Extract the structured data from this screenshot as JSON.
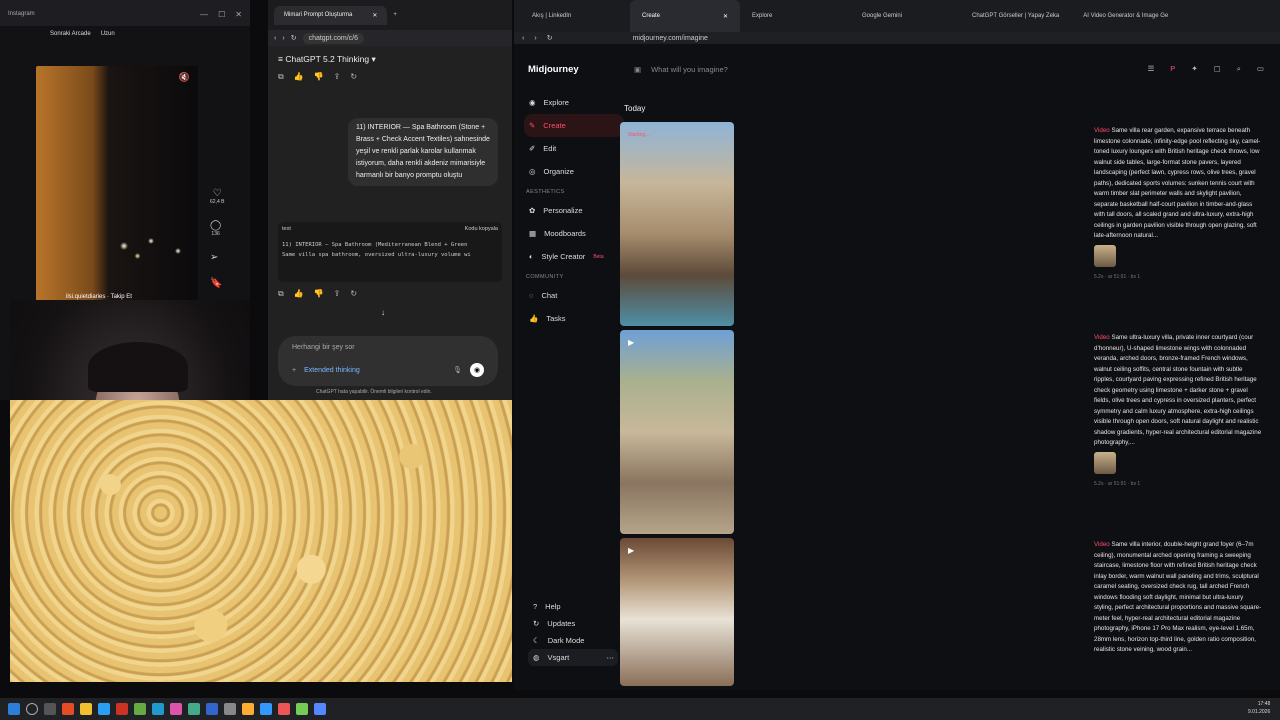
{
  "instagram": {
    "window_title": "Instagram",
    "header_items": [
      "Sonraki Arcade",
      "Uzun"
    ],
    "likes": "62,4 B",
    "comments": "136",
    "user": "ilsi.quietdiaries",
    "follow": "Takip Et"
  },
  "gpt": {
    "tab_title": "Mimari Prompt Oluşturma",
    "url": "chatgpt.com/c/6",
    "model": "ChatGPT 5.2 Thinking",
    "user_message": "11) INTERIOR — Spa Bathroom (Stone + Brass + Check Accent Textiles) sahnesinde yeşil ve renkli parlak karolar kullanmak istiyorum, daha renkli akdeniz mimarisiyle harmanlı bir banyo promptu oluştu",
    "code_lang": "text",
    "copy_label": "Kodu kopyala",
    "code_line1": "11) INTERIOR — Spa Bathroom (Mediterranean Blend + Green",
    "code_line2": "Same villa spa bathroom, oversized ultra-luxury volume wi",
    "input_placeholder": "Herhangi bir şey sor",
    "thinking": "Extended thinking",
    "disclaimer": "ChatGPT hata yapabilir. Önemli bilgileri kontrol edin."
  },
  "mj": {
    "tabs": [
      "Akış | LinkedIn",
      "Create",
      "Explore",
      "Google Gemini",
      "ChatGPT Görseller | Yapay Zeka",
      "AI Video Generator & Image Ge"
    ],
    "url": "midjourney.com/imagine",
    "brand": "Midjourney",
    "search_placeholder": "What will you imagine?",
    "nav": [
      "Explore",
      "Create",
      "Edit",
      "Organize"
    ],
    "aesthetics_label": "AESTHETICS",
    "aesthetics": [
      "Personalize",
      "Moodboards",
      "Style Creator"
    ],
    "beta": "Beta",
    "community_label": "COMMUNITY",
    "community": [
      "Chat",
      "Tasks"
    ],
    "bottom": [
      "Help",
      "Updates",
      "Dark Mode"
    ],
    "user": "Vsgart",
    "today": "Today",
    "starting": "Starting...",
    "prompts": [
      {
        "tag": "Video",
        "text": "Same villa rear garden, expansive terrace beneath limestone colonnade, infinity-edge pool reflecting sky, camel-toned luxury loungers with British heritage check throws, low walnut side tables, large-format stone pavers, layered landscaping (perfect lawn, cypress rows, olive trees, gravel paths), dedicated sports volumes: sunken tennis court with warm timber slat perimeter walls and skylight pavilion, separate basketball half-court pavilion in timber-and-glass with tall doors, all scaled grand and ultra-luxury, extra-high ceilings in garden pavilion visible through open glazing, soft late-afternoon natural...",
        "meta": "5.2s · ar 51:91 · bs 1"
      },
      {
        "tag": "Video",
        "text": "Same ultra-luxury villa, private inner courtyard (cour d’honneur), U-shaped limestone wings with colonnaded veranda, arched doors, bronze-framed French windows, walnut ceiling soffits, central stone fountain with subtle ripples, courtyard paving expressing refined British heritage check geometry using limestone + darker stone + gravel fields, olive trees and cypress in oversized planters, perfect symmetry and calm luxury atmosphere, extra-high ceilings visible through open doors, soft natural daylight and realistic shadow gradients, hyper-real architectural editorial magazine photography,...",
        "meta": "5.2s · ar 51:91 · bs 1"
      },
      {
        "tag": "Video",
        "text": "Same villa interior, double-height grand foyer (6–7m ceiling), monumental arched opening framing a sweeping staircase, limestone floor with refined British heritage check inlay border, warm walnut wall paneling and trims, sculptural caramel seating, oversized check rug, tall arched French windows flooding soft daylight, minimal but ultra-luxury styling, perfect architectural proportions and massive square-meter feel, hyper-real architectural editorial magazine photography, iPhone 17 Pro Max realism, eye-level 1.65m, 28mm lens, horizon top-third line, golden ratio composition, realistic stone veining, wood grain..."
      }
    ]
  },
  "clock": {
    "time": "17:48",
    "date": "9.01.2026"
  }
}
